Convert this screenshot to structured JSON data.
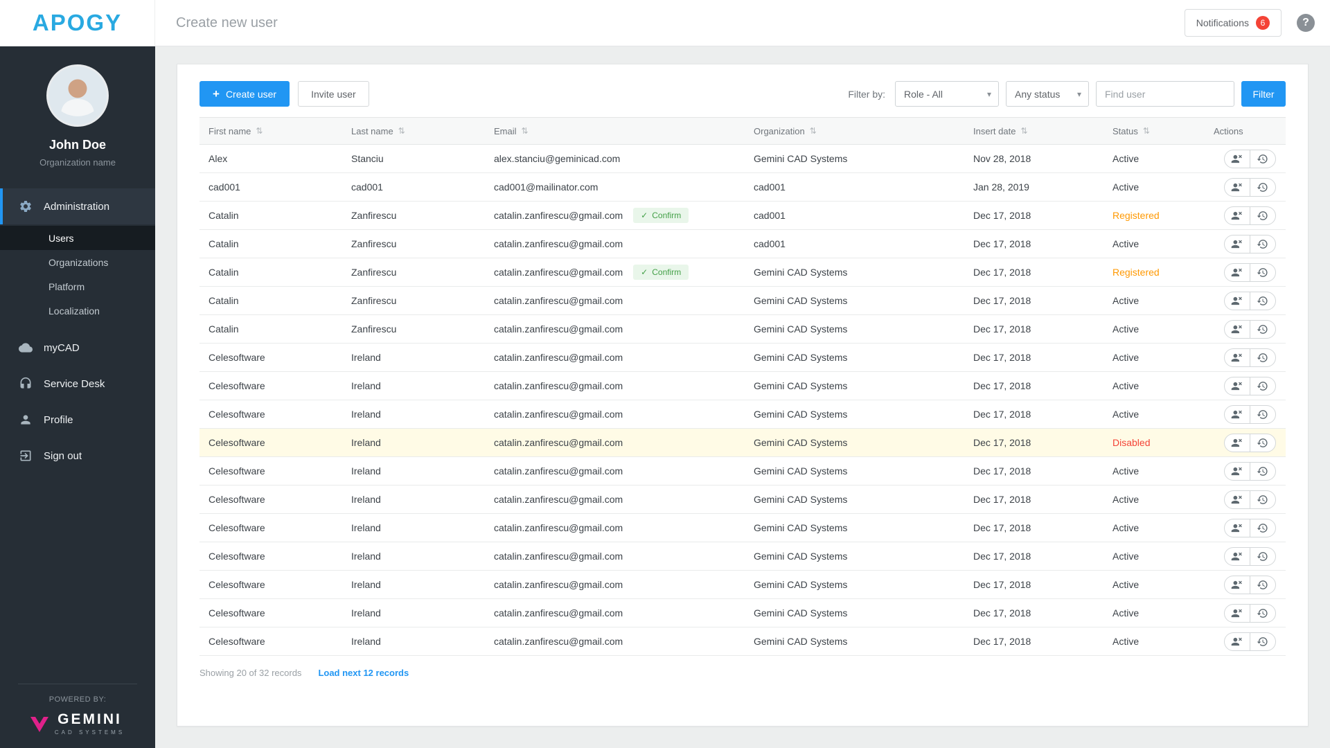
{
  "colors": {
    "accent": "#2196f3",
    "logo-blue": "#29a9e1",
    "badge-red": "#f44336",
    "confirm-green": "#43a047",
    "confirm-bg": "#e9f6ea",
    "status-registered": "#ff9800",
    "status-disabled": "#f44336",
    "row-disabled-bg": "#fffbe6",
    "sidebar-bg": "#262e36",
    "sidebar-admin-bg": "#2e3741",
    "sidebar-selected-bg": "#161c21",
    "gemini-pink": "#e0218a"
  },
  "app": {
    "logo": "APOGY",
    "page_title": "Create new user",
    "notifications_label": "Notifications",
    "notifications_count": "6",
    "help_glyph": "?"
  },
  "sidebar": {
    "user_name": "John Doe",
    "user_org": "Organization name",
    "admin_label": "Administration",
    "admin_icon": "gear-icon",
    "admin_children": [
      "Users",
      "Organizations",
      "Platform",
      "Localization"
    ],
    "items": [
      {
        "label": "myCAD",
        "icon": "cloud-icon"
      },
      {
        "label": "Service Desk",
        "icon": "headset-icon"
      },
      {
        "label": "Profile",
        "icon": "person-icon"
      },
      {
        "label": "Sign out",
        "icon": "sign-out-icon"
      }
    ],
    "powered_by": "POWERED BY:",
    "brand_name": "GEMINI",
    "brand_sub": "CAD SYSTEMS",
    "brand_icon": "gemini-v-icon"
  },
  "toolbar": {
    "plus_glyph": "+",
    "create_user": "Create user",
    "invite_user": "Invite user",
    "filter_by": "Filter by:",
    "role_value": "Role - All",
    "status_value": "Any status",
    "caret_glyph": "▾",
    "find_placeholder": "Find user",
    "filter_button": "Filter"
  },
  "table": {
    "columns": [
      "First name",
      "Last name",
      "Email",
      "Organization",
      "Insert date",
      "Status",
      "Actions"
    ],
    "sort_glyph": "⇅",
    "confirm_check": "✓",
    "confirm_label": "Confirm",
    "row_action_icons": [
      "remove-user-icon",
      "history-icon"
    ],
    "rows": [
      {
        "first": "Alex",
        "last": "Stanciu",
        "email": "alex.stanciu@geminicad.com",
        "org": "Gemini CAD Systems",
        "date": "Nov 28, 2018",
        "status": "Active",
        "status_class": "active"
      },
      {
        "first": "cad001",
        "last": "cad001",
        "email": "cad001@mailinator.com",
        "org": "cad001",
        "date": "Jan 28, 2019",
        "status": "Active",
        "status_class": "active"
      },
      {
        "first": "Catalin",
        "last": "Zanfirescu",
        "email": "catalin.zanfirescu@gmail.com",
        "confirm": true,
        "org": "cad001",
        "date": "Dec 17, 2018",
        "status": "Registered",
        "status_class": "registered"
      },
      {
        "first": "Catalin",
        "last": "Zanfirescu",
        "email": "catalin.zanfirescu@gmail.com",
        "org": "cad001",
        "date": "Dec 17, 2018",
        "status": "Active",
        "status_class": "active"
      },
      {
        "first": "Catalin",
        "last": "Zanfirescu",
        "email": "catalin.zanfirescu@gmail.com",
        "confirm": true,
        "org": "Gemini CAD Systems",
        "date": "Dec 17, 2018",
        "status": "Registered",
        "status_class": "registered"
      },
      {
        "first": "Catalin",
        "last": "Zanfirescu",
        "email": "catalin.zanfirescu@gmail.com",
        "org": "Gemini CAD Systems",
        "date": "Dec 17, 2018",
        "status": "Active",
        "status_class": "active"
      },
      {
        "first": "Catalin",
        "last": "Zanfirescu",
        "email": "catalin.zanfirescu@gmail.com",
        "org": "Gemini CAD Systems",
        "date": "Dec 17, 2018",
        "status": "Active",
        "status_class": "active"
      },
      {
        "first": "Celesoftware",
        "last": "Ireland",
        "email": "catalin.zanfirescu@gmail.com",
        "org": "Gemini CAD Systems",
        "date": "Dec 17, 2018",
        "status": "Active",
        "status_class": "active"
      },
      {
        "first": "Celesoftware",
        "last": "Ireland",
        "email": "catalin.zanfirescu@gmail.com",
        "org": "Gemini CAD Systems",
        "date": "Dec 17, 2018",
        "status": "Active",
        "status_class": "active"
      },
      {
        "first": "Celesoftware",
        "last": "Ireland",
        "email": "catalin.zanfirescu@gmail.com",
        "org": "Gemini CAD Systems",
        "date": "Dec 17, 2018",
        "status": "Active",
        "status_class": "active"
      },
      {
        "first": "Celesoftware",
        "last": "Ireland",
        "email": "catalin.zanfirescu@gmail.com",
        "org": "Gemini CAD Systems",
        "date": "Dec 17, 2018",
        "status": "Disabled",
        "status_class": "disabled"
      },
      {
        "first": "Celesoftware",
        "last": "Ireland",
        "email": "catalin.zanfirescu@gmail.com",
        "org": "Gemini CAD Systems",
        "date": "Dec 17, 2018",
        "status": "Active",
        "status_class": "active"
      },
      {
        "first": "Celesoftware",
        "last": "Ireland",
        "email": "catalin.zanfirescu@gmail.com",
        "org": "Gemini CAD Systems",
        "date": "Dec 17, 2018",
        "status": "Active",
        "status_class": "active"
      },
      {
        "first": "Celesoftware",
        "last": "Ireland",
        "email": "catalin.zanfirescu@gmail.com",
        "org": "Gemini CAD Systems",
        "date": "Dec 17, 2018",
        "status": "Active",
        "status_class": "active"
      },
      {
        "first": "Celesoftware",
        "last": "Ireland",
        "email": "catalin.zanfirescu@gmail.com",
        "org": "Gemini CAD Systems",
        "date": "Dec 17, 2018",
        "status": "Active",
        "status_class": "active"
      },
      {
        "first": "Celesoftware",
        "last": "Ireland",
        "email": "catalin.zanfirescu@gmail.com",
        "org": "Gemini CAD Systems",
        "date": "Dec 17, 2018",
        "status": "Active",
        "status_class": "active"
      },
      {
        "first": "Celesoftware",
        "last": "Ireland",
        "email": "catalin.zanfirescu@gmail.com",
        "org": "Gemini CAD Systems",
        "date": "Dec 17, 2018",
        "status": "Active",
        "status_class": "active"
      },
      {
        "first": "Celesoftware",
        "last": "Ireland",
        "email": "catalin.zanfirescu@gmail.com",
        "org": "Gemini CAD Systems",
        "date": "Dec 17, 2018",
        "status": "Active",
        "status_class": "active"
      }
    ]
  },
  "footer": {
    "showing": "Showing 20 of 32 records",
    "load_more": "Load next 12 records"
  }
}
